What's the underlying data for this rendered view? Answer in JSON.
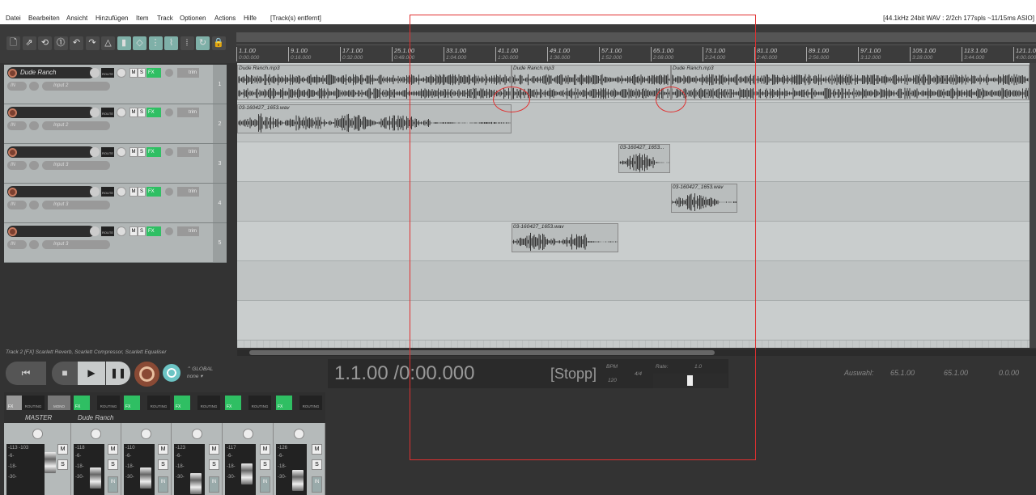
{
  "menu": [
    "Datei",
    "Bearbeiten",
    "Ansicht",
    "Hinzufügen",
    "Item",
    "Track",
    "Optionen",
    "Actions",
    "Hilfe"
  ],
  "status": "[Track(s) entfernt]",
  "audio_info": "[44.1kHz 24bit WAV : 2/2ch 177spls ~11/15ms ASIO]",
  "ruler": [
    {
      "bar": "1.1.00",
      "time": "0:00.000"
    },
    {
      "bar": "9.1.00",
      "time": "0:16.000"
    },
    {
      "bar": "17.1.00",
      "time": "0:32.000"
    },
    {
      "bar": "25.1.00",
      "time": "0:48.000"
    },
    {
      "bar": "33.1.00",
      "time": "1:04.000"
    },
    {
      "bar": "41.1.00",
      "time": "1:20.000"
    },
    {
      "bar": "49.1.00",
      "time": "1:36.000"
    },
    {
      "bar": "57.1.00",
      "time": "1:52.000"
    },
    {
      "bar": "65.1.00",
      "time": "2:08.000"
    },
    {
      "bar": "73.1.00",
      "time": "2:24.000"
    },
    {
      "bar": "81.1.00",
      "time": "2:40.000"
    },
    {
      "bar": "89.1.00",
      "time": "2:56.000"
    },
    {
      "bar": "97.1.00",
      "time": "3:12.000"
    },
    {
      "bar": "105.1.00",
      "time": "3:28.000"
    },
    {
      "bar": "113.1.00",
      "time": "3:44.000"
    },
    {
      "bar": "121.1.00",
      "time": "4:00.000"
    }
  ],
  "tracks": [
    {
      "num": "1",
      "name": "Dude Ranch",
      "input": "Input 2"
    },
    {
      "num": "2",
      "name": "",
      "input": "Input 2"
    },
    {
      "num": "3",
      "name": "",
      "input": "Input 3"
    },
    {
      "num": "4",
      "name": "",
      "input": "Input 3"
    },
    {
      "num": "5",
      "name": "",
      "input": "Input 3"
    }
  ],
  "track_labels": {
    "in": "IN",
    "route": "ROUTE",
    "m": "M",
    "s": "S",
    "fx": "FX",
    "trim": "trim"
  },
  "items": [
    {
      "name": "Dude Ranch.mp3",
      "track": 0
    },
    {
      "name": "Dude Ranch.mp3",
      "track": 0
    },
    {
      "name": "Dude Ranch.mp3",
      "track": 0
    },
    {
      "name": "03-160427_1653.wav",
      "track": 1
    },
    {
      "name": "03-160427_1653...",
      "track": 2
    },
    {
      "name": "03-160427_1653.wav",
      "track": 3
    },
    {
      "name": "03-160427_1653.wav",
      "track": 4
    }
  ],
  "fx_line": "Track 2 [FX] Scarlett Reverb, Scarlett Compressor, Scarlett Equaliser",
  "transport": {
    "global": "GLOBAL",
    "none": "none",
    "time": "1.1.00 /0:00.000",
    "state": "[Stopp]",
    "bpm_label": "BPM",
    "bpm": "120",
    "sig": "4/4",
    "rate_label": "Rate:",
    "rate": "1.0",
    "sel_label": "Auswahl:",
    "sel_start": "65.1.00",
    "sel_end": "65.1.00",
    "sel_len": "0.0.00"
  },
  "mixer": {
    "master": "MASTER",
    "routing": "ROUTING",
    "mono": "MONO",
    "strip_name": "Dude Ranch",
    "fx": "FX",
    "m": "M",
    "s": "S",
    "in": "IN",
    "peaks": [
      "-113  -103",
      "-118",
      "-110",
      "-123",
      "-117",
      "-126"
    ],
    "scale": [
      "-6-",
      "-18-",
      "-30-"
    ]
  }
}
